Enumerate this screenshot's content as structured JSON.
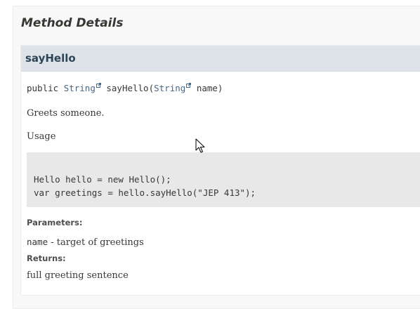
{
  "section": {
    "title": "Method Details"
  },
  "method": {
    "name": "sayHello",
    "signature": {
      "modifier": "public",
      "return_type": "String",
      "method_name": "sayHello",
      "open_paren": "(",
      "param_type": "String",
      "param_name": "name",
      "close_paren": ")"
    },
    "description": "Greets someone.",
    "usage_label": "Usage",
    "code_lines": [
      "Hello hello = new Hello();",
      "var greetings = hello.sayHello(\"JEP 413\");"
    ],
    "parameters_label": "Parameters:",
    "parameters": [
      {
        "name": "name",
        "separator": " - ",
        "description": "target of greetings"
      }
    ],
    "returns_label": "Returns:",
    "returns_description": "full greeting sentence"
  },
  "icons": {
    "external_link": "external-link-icon",
    "cursor": "mouse-pointer-icon"
  },
  "colors": {
    "header_background": "#dee3e9",
    "code_background": "#e8e8e8",
    "link_color": "#4a6782",
    "text_color": "#353833"
  }
}
